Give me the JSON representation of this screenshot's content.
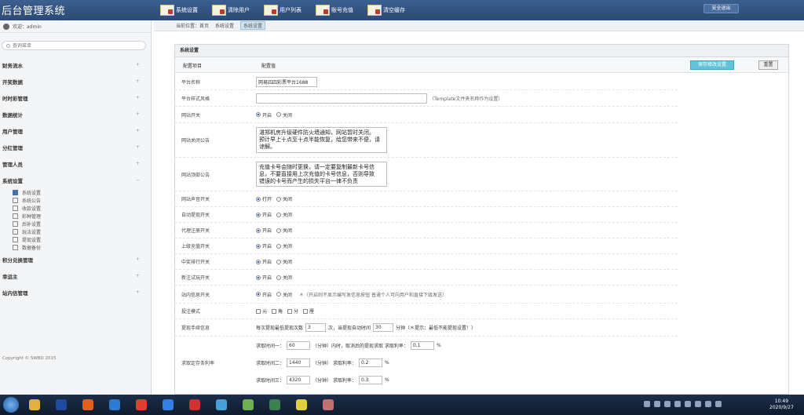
{
  "app": {
    "title": "后台管理系统"
  },
  "topnav": [
    {
      "label": "系统设置"
    },
    {
      "label": "清除用户"
    },
    {
      "label": "用户列表"
    },
    {
      "label": "账号充值"
    },
    {
      "label": "清空缓存"
    }
  ],
  "header": {
    "exit_label": "安全退出"
  },
  "sidebar": {
    "user": "欢迎：admin",
    "search_placeholder": "查询菜单",
    "menus": [
      {
        "label": "财务流水"
      },
      {
        "label": "开奖数据"
      },
      {
        "label": "时时彩管理"
      },
      {
        "label": "数据统计"
      },
      {
        "label": "用户管理"
      },
      {
        "label": "分红管理"
      },
      {
        "label": "管理人员"
      },
      {
        "label": "系统设置"
      }
    ],
    "submenu": [
      {
        "label": "系统设置"
      },
      {
        "label": "系统公告"
      },
      {
        "label": "收款设置"
      },
      {
        "label": "彩种管理"
      },
      {
        "label": "后补设置"
      },
      {
        "label": "玩法设置"
      },
      {
        "label": "提现设置"
      },
      {
        "label": "数据备份"
      }
    ],
    "menus_bottom": [
      {
        "label": "积分兑换管理"
      },
      {
        "label": "幸运主"
      },
      {
        "label": "站内信管理"
      }
    ],
    "copyright": "Copyright © SWBD 2015"
  },
  "breadcrumb": [
    "当前位置：首页",
    "系统设置",
    "系统设置"
  ],
  "panel": {
    "title": "系统设置",
    "col_item": "配置项目",
    "col_value": "配置值",
    "save_label": "保存修改设置",
    "reset_label": "重置"
  },
  "form": {
    "site_name_label": "平台名称",
    "site_name_value": "网易四四彩票平台1688",
    "template_label": "平台样式风格",
    "template_hint": "（Template文件夹名称作为设置）",
    "site_switch_label": "网站开关",
    "opt_on": "开启",
    "opt_off": "关闭",
    "close_notice_label": "网站关闭公告",
    "close_notice_value": "湛郑机房升级硬件防火墙通知，网站暂时关闭。\n预计早上十点至十点半能恢复，给您带来不便，请谅解。",
    "top_notice_label": "网站顶部公告",
    "top_notice_value": "充值卡号会随时更换，请一定要复制最新卡号信息，不要直接用上次充值的卡号信息，否则导致\n错误的卡号而产生的损失平台一律不负责",
    "sound_label": "网站声音开关",
    "open_on": "打开",
    "withdraw_label": "自动提现开关",
    "agent_label": "代理注册开关",
    "recharge_label": "上级充值开关",
    "winlist_label": "中奖排行开关",
    "trial_label": "新注试玩开关",
    "msg_label": "站内信息开关",
    "msg_hint": "＊（开启则不显示编写发信息按钮 普通个人可向用户和直接下级发送）",
    "bet_mode_label": "投注模式",
    "modes": [
      "元",
      "角",
      "分",
      "厘"
    ],
    "withdraw_limit_label": "提现手续信息",
    "withdraw_limit_pre": "每次提现最低提现次数",
    "withdraw_limit_n": "3",
    "withdraw_limit_mid": "次，当提现自动时间",
    "withdraw_limit_t": "30",
    "withdraw_limit_post": "分钟（＊提示：最低不能提现设置！）",
    "payout_label": "求取定存条利率",
    "payouts": [
      {
        "pre": "求取时间一：",
        "t": "60",
        "mid": "（分钟）内时，取消后的提现求取  求取利率：",
        "r": "0.1",
        "post": "%"
      },
      {
        "pre": "求取时间二：",
        "t": "1440",
        "mid": "（分钟）  求取利率：",
        "r": "0.2",
        "post": "%"
      },
      {
        "pre": "求取时间三：",
        "t": "4320",
        "mid": "（分钟）  求取利率：",
        "r": "0.3",
        "post": "%"
      }
    ]
  },
  "taskbar": {
    "time": "10:49",
    "date": "2020/9/27",
    "icon_colors": [
      "#e0b040",
      "#1f4aa0",
      "#e06020",
      "#2d7bd2",
      "#e04030",
      "#3380e0",
      "#d03030",
      "#48a0d8",
      "#70b050",
      "#3a8050",
      "#e0d040",
      "#c07070"
    ]
  }
}
